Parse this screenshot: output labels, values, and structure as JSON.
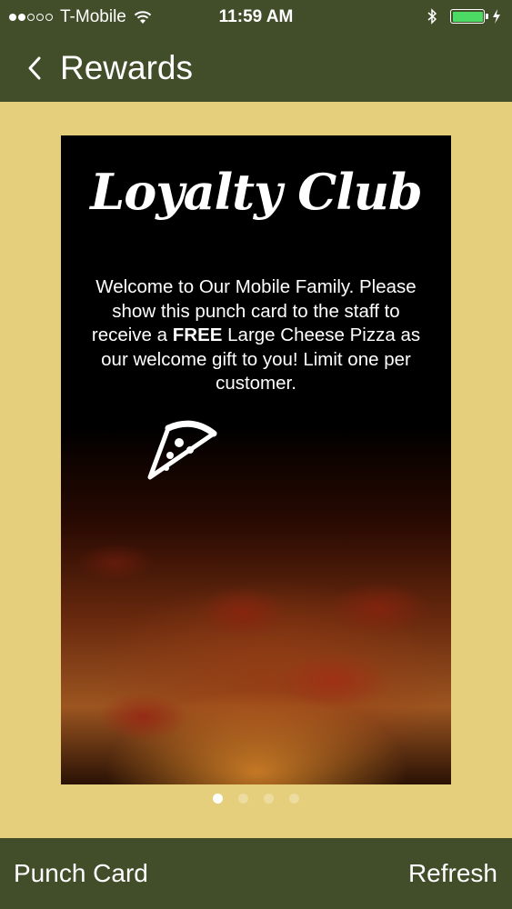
{
  "status_bar": {
    "carrier": "T-Mobile",
    "time": "11:59 AM",
    "signal_bars_filled": 2,
    "signal_bars_total": 5,
    "battery_level": 1.0,
    "colors": {
      "battery": "#4cd964"
    }
  },
  "nav": {
    "back_icon": "chevron-left-icon",
    "title": "Rewards"
  },
  "card": {
    "title": "Loyalty Club",
    "text_parts": {
      "a": "Welcome to Our Mobile Family. Please show this punch card to the staff to receive a ",
      "bold": "FREE",
      "b": " Large Cheese Pizza as our welcome gift to you! Limit one per customer."
    },
    "icon": "pizza-slice-icon",
    "background": "pepperoni pizza photo"
  },
  "pager": {
    "pages": 4,
    "current": 1
  },
  "toolbar": {
    "punch_card_label": "Punch Card",
    "refresh_label": "Refresh"
  },
  "colors": {
    "bar": "#424e2a",
    "background": "#e6cf7c",
    "card": "#000000",
    "text": "#ffffff"
  }
}
